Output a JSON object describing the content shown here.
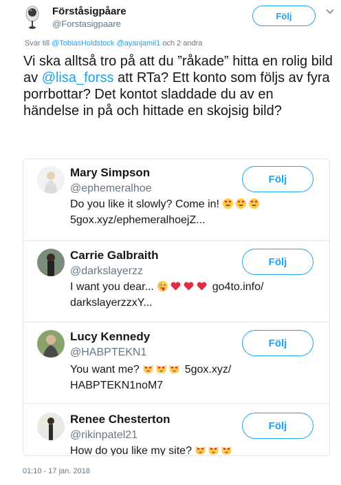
{
  "tweet": {
    "account_name": "Förståsigpåare",
    "account_handle": "@Forstasigpaare",
    "follow_label": "Följ",
    "reply_prefix": "Svar till ",
    "reply_mentions": "@TobiasHoldstock @ayanjamil1",
    "reply_suffix": " och 2 andra",
    "text_part1": "Vi ska alltså tro på att du ”råkade” hitta en rolig bild av ",
    "text_mention": "@lisa_forss",
    "text_part2": " att RTa? Ett konto som följs av fyra porrbottar? Det kontot sladdade du av en händelse in på och hittade en skojsig bild?",
    "timestamp": "01:10 - 17 jan. 2018"
  },
  "followers": [
    {
      "name": "Mary Simpson",
      "handle": "@ephemeralhoe",
      "bio_text": "Do you like it slowly? Come in! ",
      "bio_emoji": [
        "smiling-face-hearts",
        "smiling-face-hearts",
        "smiling-face-hearts"
      ],
      "bio_after": "5gox.xyz/ephemeralhoejZ...",
      "follow_label": "Följ"
    },
    {
      "name": "Carrie Galbraith",
      "handle": "@darkslayerzz",
      "bio_text": "I want you dear... ",
      "bio_emoji": [
        "zany-face",
        "red-heart",
        "red-heart",
        "red-heart"
      ],
      "bio_after": " go4to.info/ darkslayerzzxY...",
      "follow_label": "Följ"
    },
    {
      "name": "Lucy Kennedy",
      "handle": "@HABPTEKN1",
      "bio_text": "You want me? ",
      "bio_emoji": [
        "cat-heart-eyes",
        "cat-heart-eyes",
        "cat-heart-eyes"
      ],
      "bio_after": " 5gox.xyz/ HABPTEKN1noM7",
      "follow_label": "Följ"
    },
    {
      "name": "Renee Chesterton",
      "handle": "@rikinpatel21",
      "bio_text": "How do you like my site? ",
      "bio_emoji": [
        "cat-heart-eyes",
        "cat-heart-eyes",
        "cat-heart-eyes"
      ],
      "bio_after": "",
      "follow_label": "Följ"
    }
  ],
  "colors": {
    "accent": "#1da1f2",
    "muted": "#657786",
    "border": "#e1e8ed"
  }
}
